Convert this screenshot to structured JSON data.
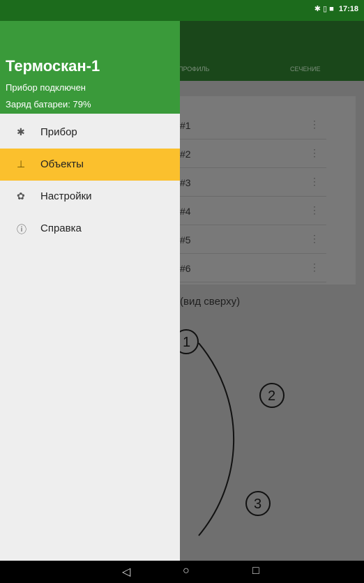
{
  "status": {
    "time": "17:18",
    "icons": "✱ ▯ ■"
  },
  "app": {
    "tabs": [
      "ПРОФИЛЬ",
      "СЕЧЕНИЕ"
    ],
    "rows": [
      "#1",
      "#2",
      "#3",
      "#4",
      "#5",
      "#6"
    ],
    "row_menu_icon": "⋮",
    "caption": "(вид сверху)",
    "diagram_labels": [
      "1",
      "2",
      "3"
    ]
  },
  "drawer": {
    "title": "Термоскан-1",
    "status": "Прибор подключен",
    "battery": "Заряд батареи: 79%",
    "items": [
      {
        "label": "Прибор",
        "icon": "bluetooth-icon",
        "glyph": "✱"
      },
      {
        "label": "Объекты",
        "icon": "object-icon",
        "glyph": "⊥"
      },
      {
        "label": "Настройки",
        "icon": "gear-icon",
        "glyph": "✿"
      },
      {
        "label": "Справка",
        "icon": "info-icon",
        "glyph": "ⓘ"
      }
    ],
    "active_index": 1
  },
  "nav": {
    "back": "◁",
    "home": "○",
    "recents": "□"
  },
  "colors": {
    "header": "#3a9a3a",
    "active": "#fbc02d",
    "statusbar": "#1c6b1c"
  }
}
